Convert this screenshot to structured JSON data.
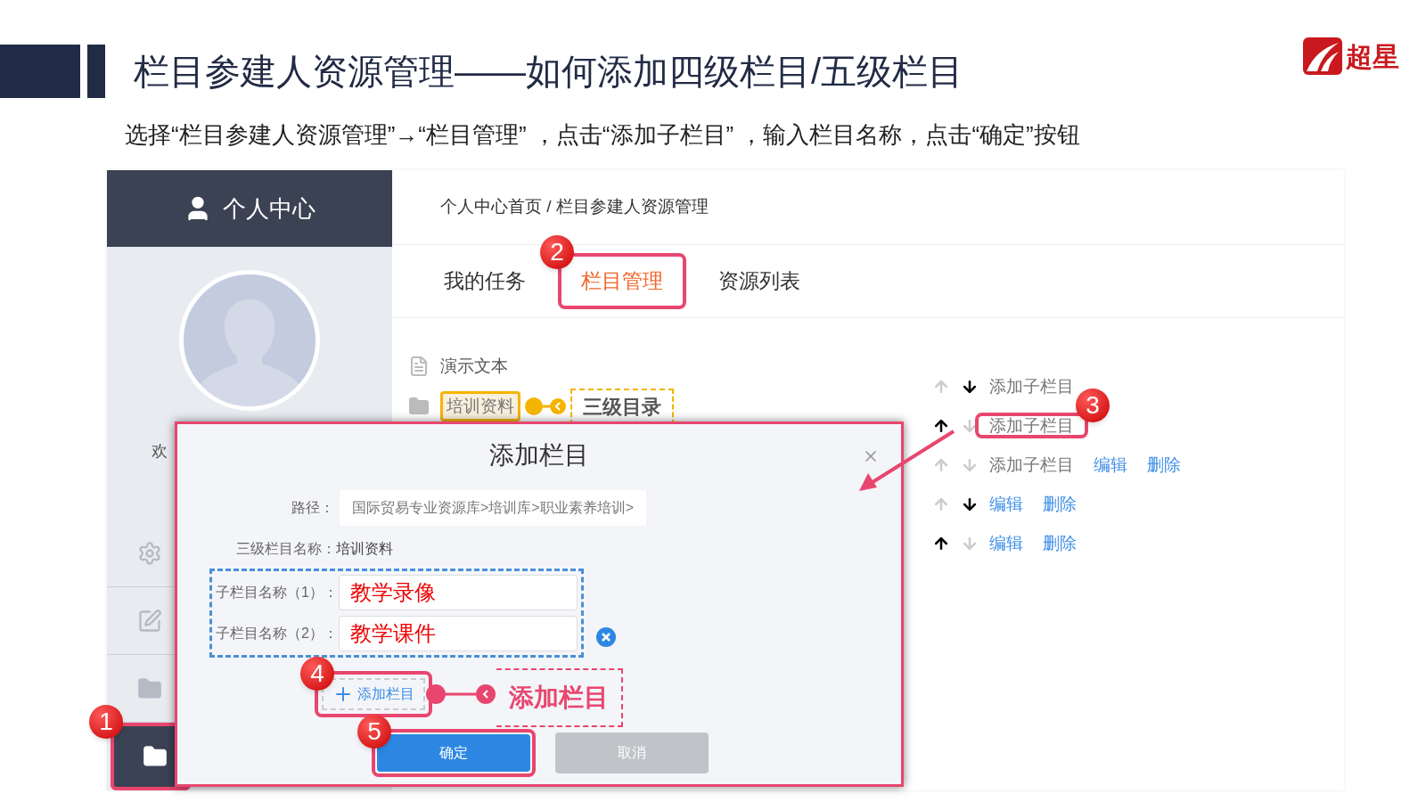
{
  "slide": {
    "title": "栏目参建人资源管理——如何添加四级栏目/五级栏目",
    "instruction": "选择“栏目参建人资源管理”→“栏目管理” ，点击“添加子栏目” ，输入栏目名称，点击“确定”按钮",
    "logo_text": "超星"
  },
  "sidebar": {
    "title": "个人中心",
    "greeting": "欢",
    "items": [
      {
        "kind": "settings",
        "selected": false
      },
      {
        "kind": "edit",
        "selected": false
      },
      {
        "kind": "folder",
        "selected": false
      },
      {
        "kind": "folder",
        "selected": true,
        "step": "1"
      }
    ]
  },
  "breadcrumb": "个人中心首页 / 栏目参建人资源管理",
  "tabs": [
    {
      "label": "我的任务",
      "selected": false
    },
    {
      "label": "栏目管理",
      "selected": true,
      "step": "2"
    },
    {
      "label": "资源列表",
      "selected": false
    }
  ],
  "tree": [
    {
      "kind": "document",
      "label": "演示文本",
      "highlighted": false
    },
    {
      "kind": "folder",
      "label": "培训资料",
      "highlighted": true,
      "callout": "三级目录"
    }
  ],
  "action_rows": [
    {
      "up_enabled": false,
      "down_enabled": true,
      "actions": [
        {
          "kind": "add",
          "label": "添加子栏目",
          "highlighted": false
        }
      ]
    },
    {
      "up_enabled": true,
      "down_enabled": false,
      "actions": [
        {
          "kind": "add",
          "label": "添加子栏目",
          "highlighted": true,
          "step": "3"
        }
      ]
    },
    {
      "up_enabled": false,
      "down_enabled": false,
      "actions": [
        {
          "kind": "add",
          "label": "添加子栏目",
          "highlighted": false
        },
        {
          "kind": "link",
          "label": "编辑",
          "highlighted": false
        },
        {
          "kind": "link",
          "label": "删除",
          "highlighted": false
        }
      ]
    },
    {
      "up_enabled": false,
      "down_enabled": true,
      "actions": [
        {
          "kind": "link",
          "label": "编辑",
          "highlighted": false
        },
        {
          "kind": "link",
          "label": "删除",
          "highlighted": false
        }
      ]
    },
    {
      "up_enabled": true,
      "down_enabled": false,
      "actions": [
        {
          "kind": "link",
          "label": "编辑",
          "highlighted": false
        },
        {
          "kind": "link",
          "label": "删除",
          "highlighted": false
        }
      ]
    }
  ],
  "dialog": {
    "title": "添加栏目",
    "path_label": "路径：",
    "path_value": "国际贸易专业资源库>培训库>职业素养培训>",
    "parent_label": "三级栏目名称：",
    "parent_value": "培训资料",
    "fields": [
      {
        "label": "子栏目名称（1）：",
        "value": "教学录像",
        "removable": false
      },
      {
        "label": "子栏目名称（2）：",
        "value": "教学课件",
        "removable": true
      }
    ],
    "add_button": {
      "label": "添加栏目",
      "step": "4",
      "callout": "添加栏目"
    },
    "confirm_button": {
      "label": "确定",
      "step": "5"
    },
    "cancel_button": {
      "label": "取消",
      "disabled": true
    }
  }
}
